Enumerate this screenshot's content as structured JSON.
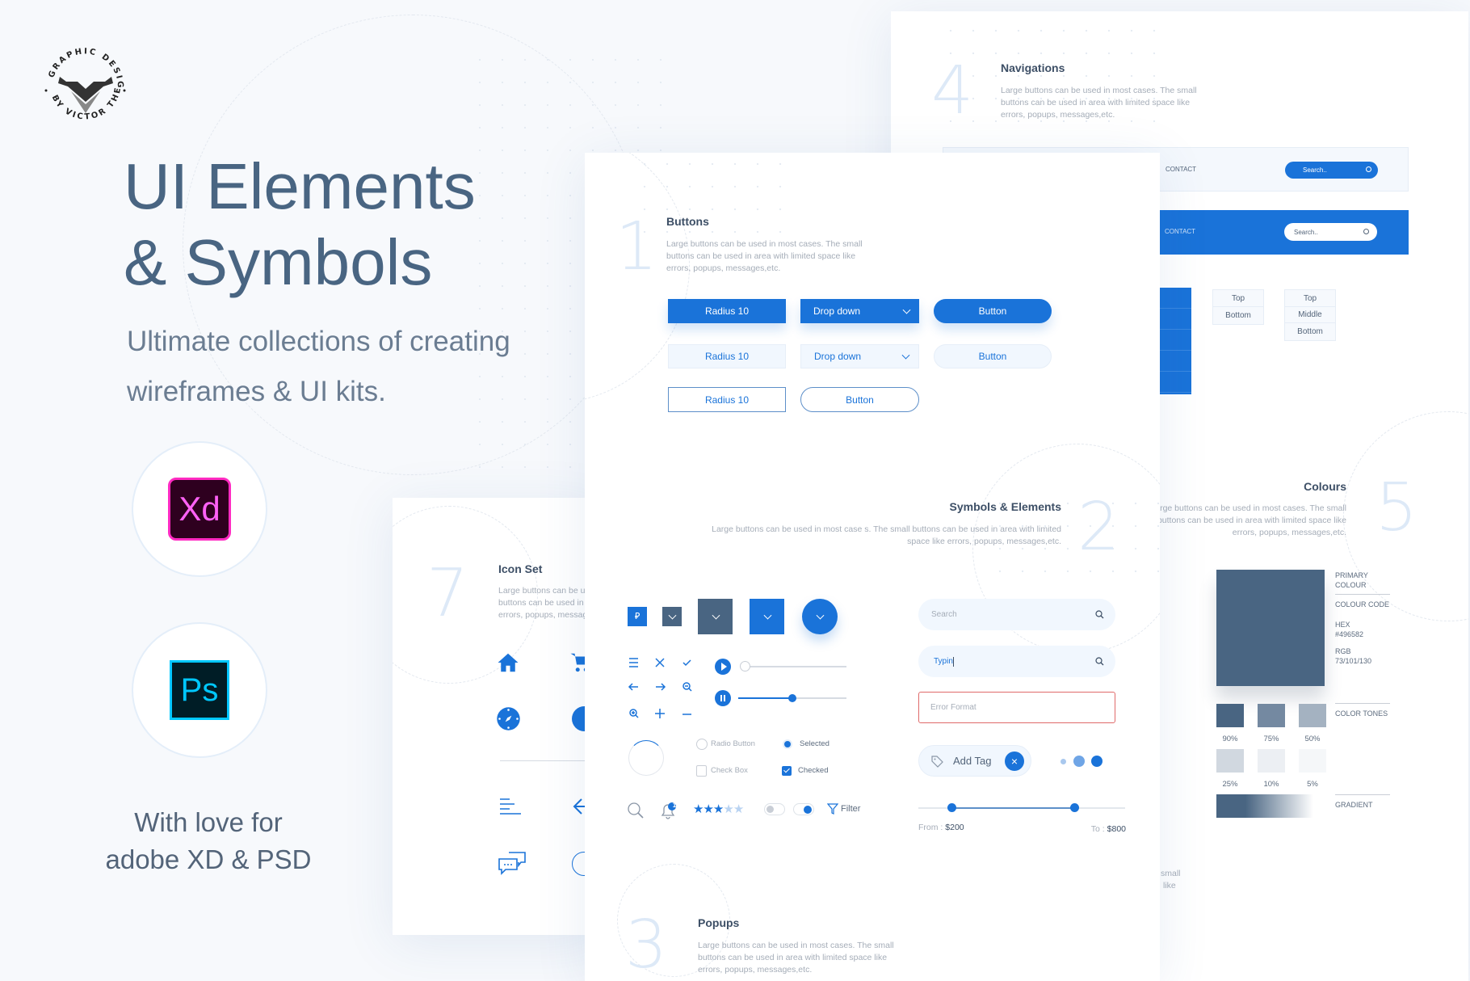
{
  "brand": {
    "logo_text_top": "GRAPHIC DESIGNS",
    "logo_text_bottom": "BY VICTOR THEMES"
  },
  "hero": {
    "title_line1": "UI Elements",
    "title_line2": "& Symbols",
    "subtitle_line1": "Ultimate collections of creating",
    "subtitle_line2": "wireframes & UI kits.",
    "app_xd": "Xd",
    "app_ps": "Ps",
    "footer_line1": "With love for",
    "footer_line2": "adobe XD & PSD"
  },
  "colors": {
    "accent": "#1a73d9",
    "primary": "#496582",
    "error": "#e06a6a"
  },
  "desc_lines": [
    "Large buttons can be used in most cases. The small",
    "buttons can be used in area with limited space like",
    "errors, popups, messages,etc."
  ],
  "buttons_section": {
    "number": "1",
    "title": "Buttons",
    "row1": [
      "Radius 10",
      "Drop down",
      "Button"
    ],
    "row2": [
      "Radius 10",
      "Drop down",
      "Button"
    ],
    "row3": [
      "Radius 10",
      "Button"
    ]
  },
  "symbols_section": {
    "number": "2",
    "title": "Symbols & Elements",
    "desc_line1": "Large buttons can be used in most case s. The small buttons can be used in area with limited",
    "desc_line2": "space like errors, popups, messages,etc.",
    "radio_label": "Radio Button",
    "radio_selected_label": "Selected",
    "checkbox_label": "Check Box",
    "checkbox_checked_label": "Checked",
    "notification_count": "1",
    "rating": 3,
    "rating_max": 5,
    "filter_label": "Filter",
    "search_placeholder": "Search",
    "typing_value": "Typin",
    "error_placeholder": "Error Format",
    "tag_label": "Add Tag",
    "slider1_value": 0,
    "slider2_value": 0.5,
    "range_from_label": "From :",
    "range_from_value": "$200",
    "range_to_label": "To :",
    "range_to_value": "$800"
  },
  "popups_section": {
    "number": "3",
    "title": "Popups"
  },
  "nav_section": {
    "number": "4",
    "title": "Navigations",
    "contact": "CONTACT",
    "search_placeholder": "Search..",
    "tabs2": [
      "Top",
      "Bottom"
    ],
    "tabs3": [
      "Top",
      "Middle",
      "Bottom"
    ]
  },
  "colours_section": {
    "number": "5",
    "title": "Colours",
    "primary_label": "PRIMARY COLOUR",
    "code_label": "COLOUR CODE",
    "hex_label": "HEX",
    "hex_value": "#496582",
    "rgb_label": "RGB",
    "rgb_value": "73/101/130",
    "tones_label": "COLOR TONES",
    "gradient_label": "GRADIENT",
    "tones": [
      {
        "pct": "90%",
        "color": "#496582"
      },
      {
        "pct": "75%",
        "color": "#7489a1"
      },
      {
        "pct": "50%",
        "color": "#a4b2c1"
      },
      {
        "pct": "25%",
        "color": "#d1d8e0"
      },
      {
        "pct": "10%",
        "color": "#eceff3"
      },
      {
        "pct": "5%",
        "color": "#f5f7f9"
      }
    ],
    "clipped_text": [
      "small",
      "like"
    ]
  },
  "icon_section": {
    "number": "7",
    "title": "Icon Set"
  }
}
